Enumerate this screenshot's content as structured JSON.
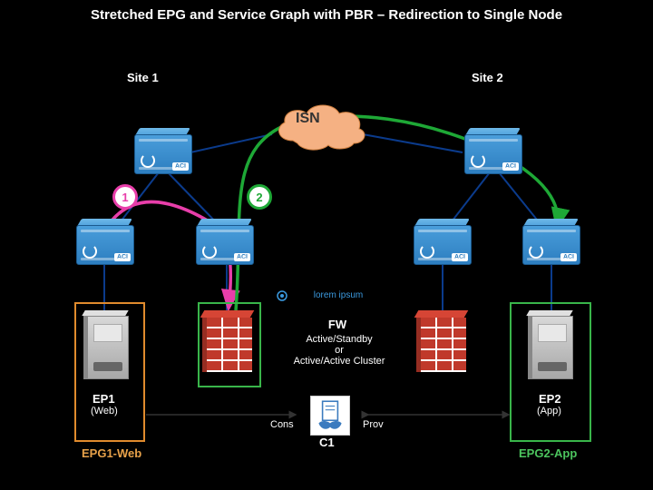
{
  "title": "Stretched EPG and Service Graph with PBR – Redirection to Single Node",
  "sites": {
    "left": "Site 1",
    "right": "Site 2"
  },
  "isn": "ISN",
  "badges": {
    "one": "1",
    "two": "2"
  },
  "devices": {
    "aci": "ACI",
    "fw_label": "FW",
    "fw_note": "Active/Standby\nor\nActive/Active Cluster",
    "stretch_link": "lorem ipsum"
  },
  "epg": {
    "web": "EPG1-Web",
    "app": "EPG2-App"
  },
  "nodes": {
    "ep1": {
      "title": "EP1",
      "sub": "(Web)"
    },
    "ep2": {
      "title": "EP2",
      "sub": "(App)"
    }
  },
  "contract": {
    "c1": "C1",
    "role_cons": "Cons",
    "role_prov": "Prov"
  },
  "colors": {
    "pink": "#e83eaa",
    "green": "#1ea836",
    "orange": "#e08b2d",
    "greenbox": "#39b54a",
    "blue": "#0b3b8c"
  }
}
